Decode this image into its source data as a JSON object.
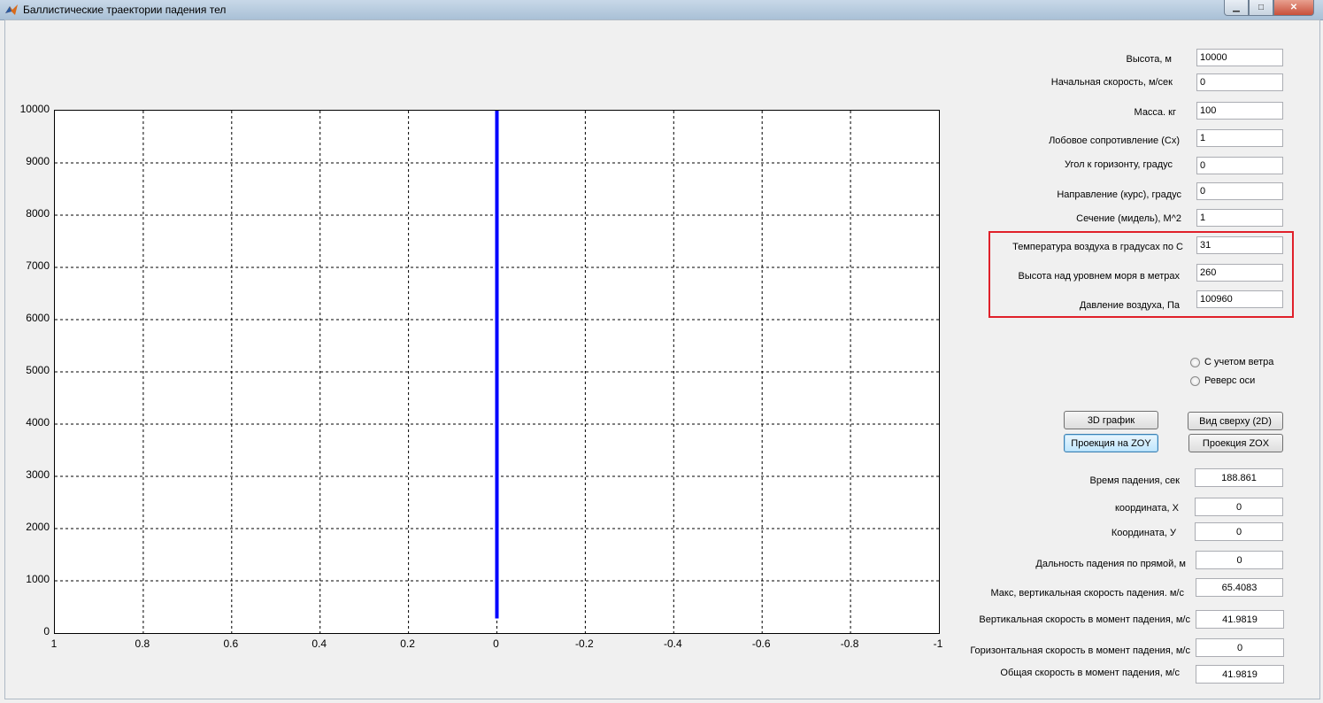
{
  "window": {
    "title": "Баллистические траектории падения тел",
    "close_glyph": "✕",
    "minimize_glyph": "▁",
    "maximize_glyph": "□"
  },
  "inputs": [
    {
      "label": "Высота, м",
      "value": "10000"
    },
    {
      "label": "Начальная скорость, м/сек",
      "value": "0"
    },
    {
      "label": "Масса. кг",
      "value": "100"
    },
    {
      "label": "Лобовое сопротивление (Cx)",
      "value": "1"
    },
    {
      "label": "Угол к горизонту, градус",
      "value": "0"
    },
    {
      "label": "Направление  (курс), градус",
      "value": "0"
    },
    {
      "label": "Сечение (мидель), M^2",
      "value": "1"
    },
    {
      "label": "Температура воздуха в градусах по С",
      "value": "31"
    },
    {
      "label": "Высота над уровнем моря в метрах",
      "value": "260"
    },
    {
      "label": "Давление воздуха, Па",
      "value": "100960"
    }
  ],
  "options": {
    "wind": "С учетом ветра",
    "reverse": "Реверс оси"
  },
  "buttons": {
    "plot3d": "3D график",
    "top_view": "Вид сверху (2D)",
    "zoy": "Проекция на ZOY",
    "zox": "Проекция ZOX"
  },
  "outputs": [
    {
      "label": "Время падения, сек",
      "value": "188.861"
    },
    {
      "label": "координата, X",
      "value": "0"
    },
    {
      "label": "Координата, У",
      "value": "0"
    },
    {
      "label": "Дальность падения по прямой, м",
      "value": "0"
    },
    {
      "label": "Макс,  вертикальная скорость падения. м/с",
      "value": "65.4083"
    },
    {
      "label": "Вертикальная  скорость в момент падения, м/с",
      "value": "41.9819"
    },
    {
      "label": "Горизонтальная скорость в момент падения, м/с",
      "value": "0"
    },
    {
      "label": "Общая скорость в момент падения, м/с",
      "value": "41.9819"
    }
  ],
  "chart_data": {
    "type": "line",
    "title": "",
    "xlabel": "",
    "ylabel": "",
    "xlim": [
      1,
      -1
    ],
    "ylim": [
      0,
      10000
    ],
    "x_reversed": true,
    "grid": true,
    "x_ticks": [
      "1",
      "0.8",
      "0.6",
      "0.4",
      "0.2",
      "0",
      "-0.2",
      "-0.4",
      "-0.6",
      "-0.8",
      "-1"
    ],
    "y_ticks": [
      "0",
      "1000",
      "2000",
      "3000",
      "4000",
      "5000",
      "6000",
      "7000",
      "8000",
      "9000",
      "10000"
    ],
    "series": [
      {
        "color": "#0000ff",
        "x": [
          0,
          0
        ],
        "y": [
          10000,
          280
        ]
      }
    ]
  }
}
